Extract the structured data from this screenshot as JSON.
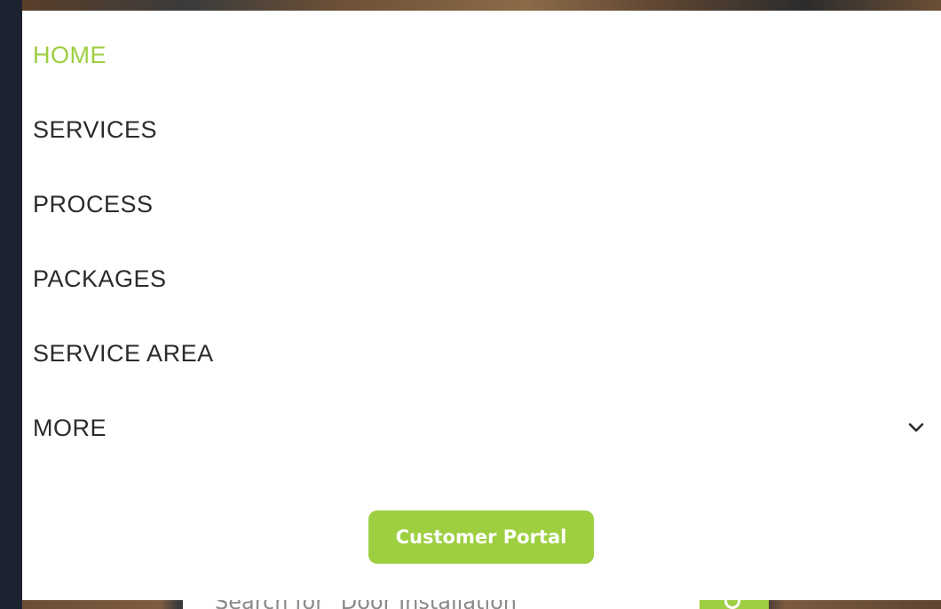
{
  "menu": {
    "items": [
      {
        "label": "HOME",
        "active": true
      },
      {
        "label": "SERVICES"
      },
      {
        "label": "PROCESS"
      },
      {
        "label": "PACKAGES"
      },
      {
        "label": "SERVICE AREA"
      },
      {
        "label": "MORE",
        "has_submenu": true,
        "icon": "chevron-down-icon"
      }
    ],
    "portal_button_label": "Customer Portal"
  },
  "background": {
    "search_placeholder": "Search for \"Door Installation\"",
    "search_button_icon": "search-icon"
  },
  "colors": {
    "accent": "#9dcf40",
    "menu_text": "#2b2b2b",
    "panel_bg": "#ffffff",
    "page_bg": "#1e2431"
  }
}
